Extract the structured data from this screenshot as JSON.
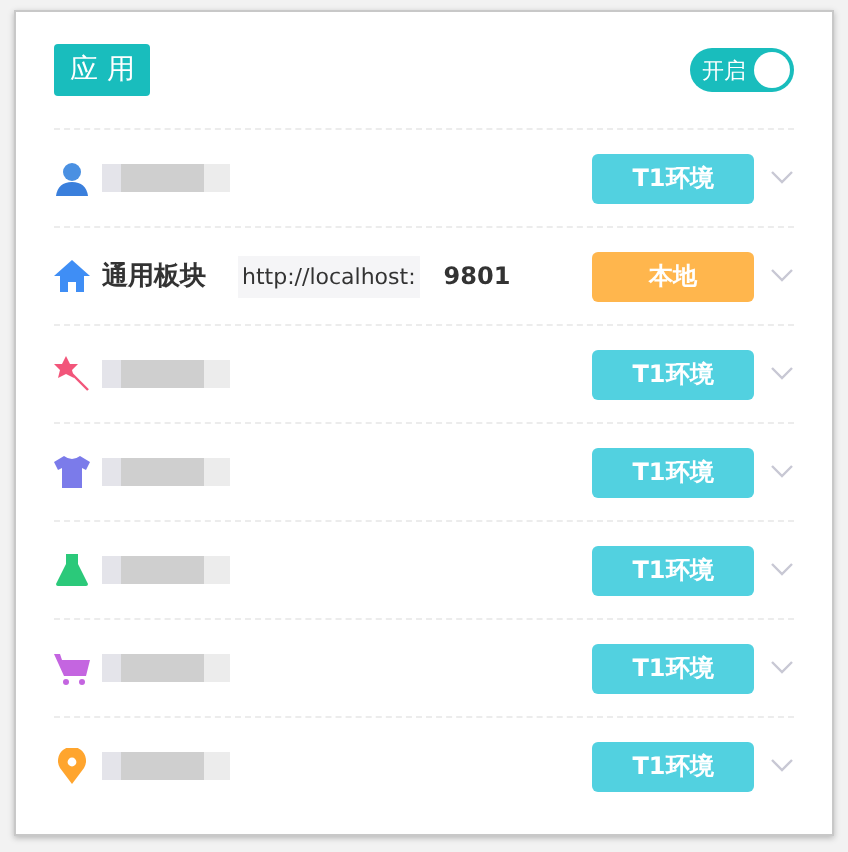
{
  "header": {
    "title": "应 用",
    "toggle": {
      "label": "开启",
      "on": true
    }
  },
  "rows": [
    {
      "kind": "redacted",
      "env": {
        "label": "T1环境",
        "color": "#52d1e0"
      }
    },
    {
      "kind": "module",
      "name": "通用板块",
      "url_prefix": "http://localhost:",
      "port": "9801",
      "env": {
        "label": "本地",
        "color": "#ffb64d"
      }
    },
    {
      "kind": "redacted",
      "env": {
        "label": "T1环境",
        "color": "#52d1e0"
      }
    },
    {
      "kind": "redacted",
      "env": {
        "label": "T1环境",
        "color": "#52d1e0"
      }
    },
    {
      "kind": "redacted",
      "env": {
        "label": "T1环境",
        "color": "#52d1e0"
      }
    },
    {
      "kind": "redacted",
      "env": {
        "label": "T1环境",
        "color": "#52d1e0"
      }
    },
    {
      "kind": "redacted",
      "env": {
        "label": "T1环境",
        "color": "#52d1e0"
      }
    }
  ]
}
